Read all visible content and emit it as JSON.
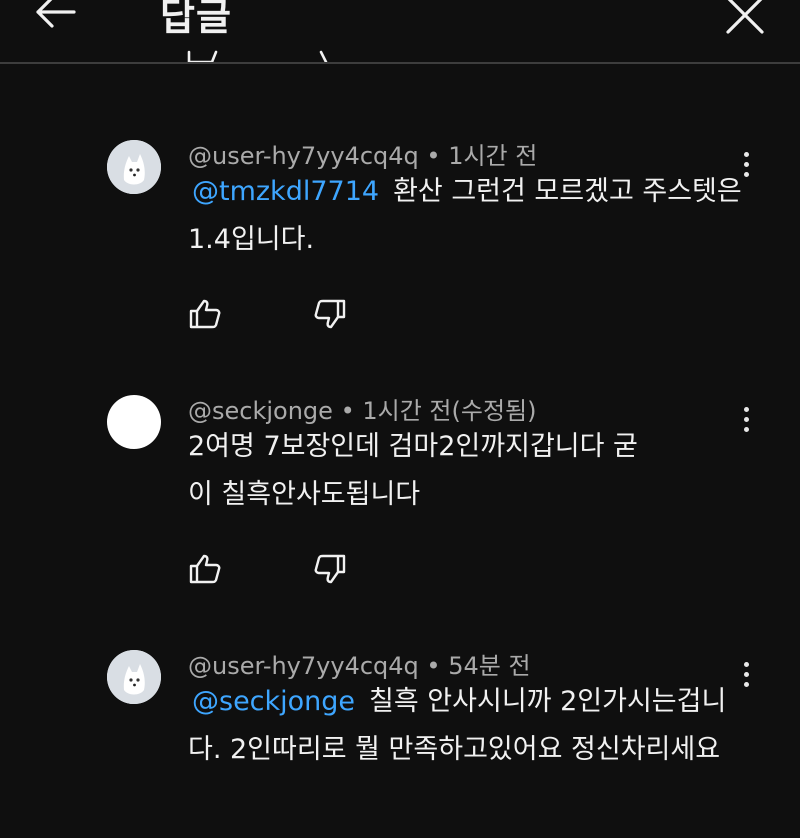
{
  "header": {
    "title": "답글",
    "back_icon": "arrow-left-icon",
    "close_icon": "close-icon"
  },
  "comments": [
    {
      "author": "@user-hy7yy4cq4q",
      "time": "1시간 전",
      "mention": "@tmzkdl7714",
      "text": "환산 그런건 모르겠고 주스텟은 1.4입니다.",
      "avatar": "fox-avatar"
    },
    {
      "author": "@seckjonge",
      "time": "1시간 전(수정됨)",
      "mention": "",
      "text": "2여명 7보장인데 검마2인까지갑니다 굳이 칠흑안사도됩니다",
      "avatar": "white-avatar"
    },
    {
      "author": "@user-hy7yy4cq4q",
      "time": "54분 전",
      "mention": "@seckjonge",
      "text": "칠흑 안사시니까 2인가시는겁니다. 2인따리로 뭘 만족하고있어요 정신차리세요",
      "avatar": "fox-avatar"
    }
  ],
  "colors": {
    "background": "#0f0f0f",
    "text": "#f1f1f1",
    "meta": "#aaaaaa",
    "mention": "#3ea6ff",
    "divider": "#3d3d3d"
  }
}
